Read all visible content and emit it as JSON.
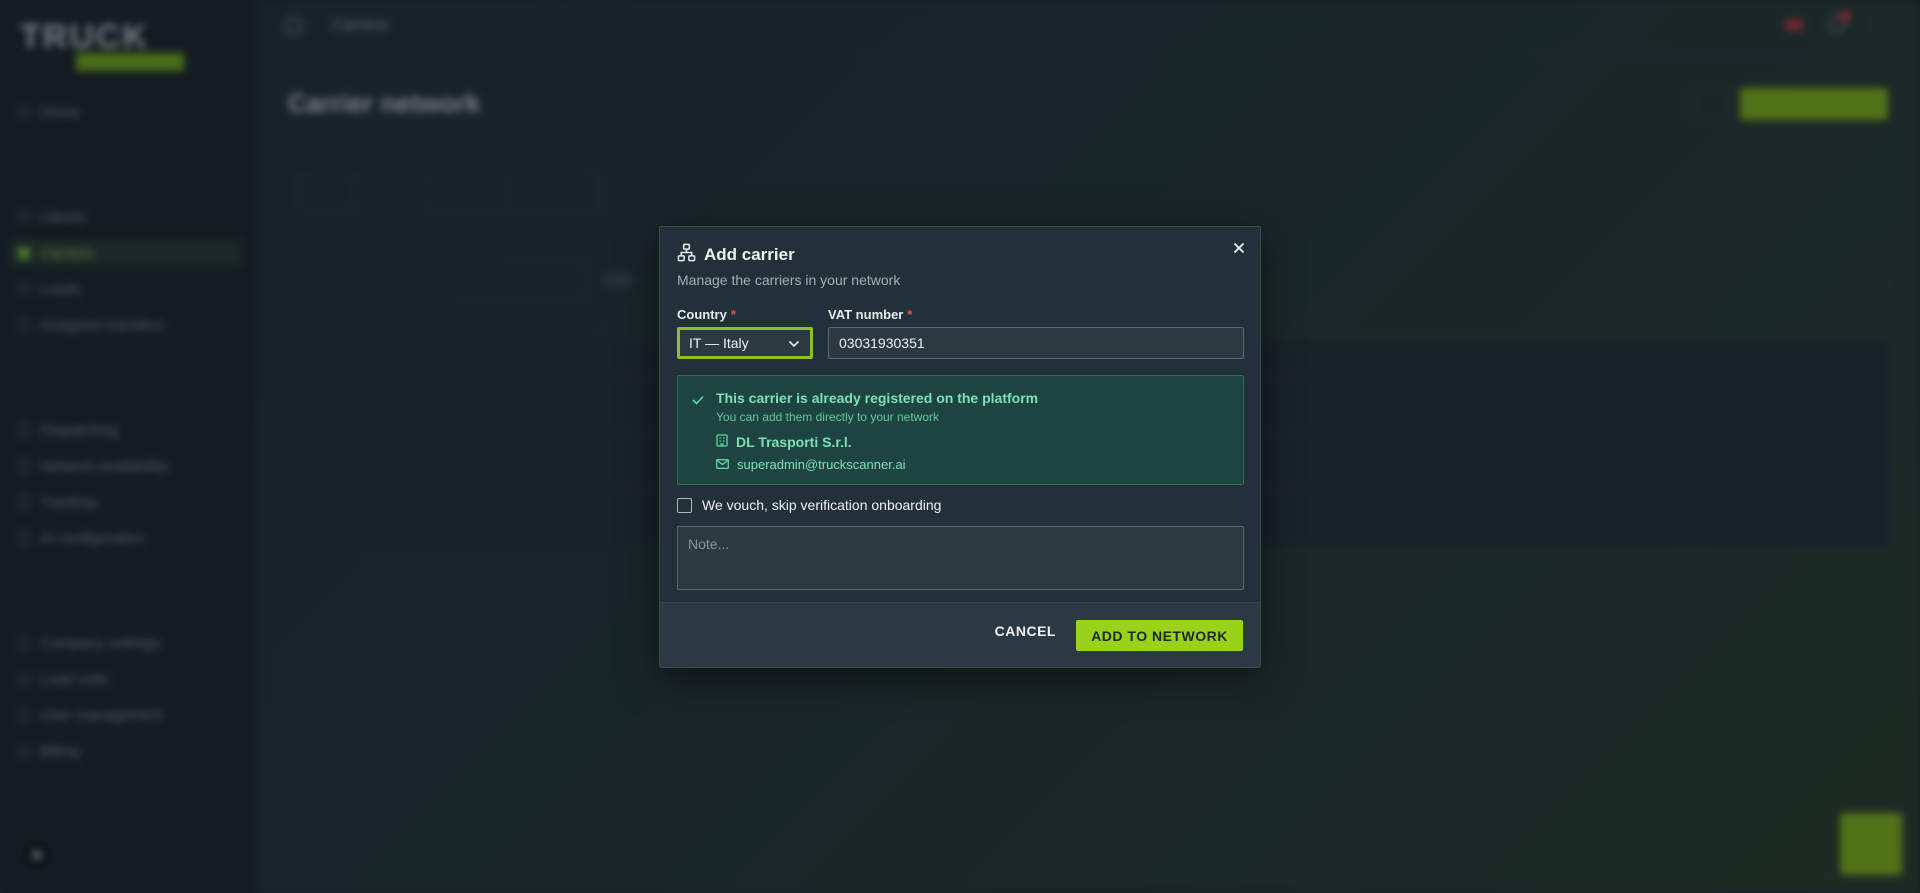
{
  "background": {
    "logo_text": "TRUCK",
    "sidebar": {
      "items": [
        {
          "label": "Home",
          "active": false
        },
        {
          "label": "Clients",
          "active": false
        },
        {
          "label": "Carriers",
          "active": true
        },
        {
          "label": "Loads",
          "active": false
        },
        {
          "label": "Assigned transfers",
          "active": false
        },
        {
          "label": "Dispatching",
          "active": false
        },
        {
          "label": "Network availability",
          "active": false
        },
        {
          "label": "Tracking",
          "active": false
        },
        {
          "label": "AI configuration",
          "active": false
        },
        {
          "label": "Company settings",
          "active": false
        },
        {
          "label": "Load units",
          "active": false
        },
        {
          "label": "User management",
          "active": false
        },
        {
          "label": "Billing",
          "active": false
        }
      ]
    },
    "user": {
      "initial": "N"
    },
    "topbar": {
      "breadcrumb": "Carriers"
    },
    "page_title": "Carrier network"
  },
  "modal": {
    "title": "Add carrier",
    "subtitle": "Manage the carriers in your network",
    "country_label": "Country",
    "country_value": "IT — Italy",
    "vat_label": "VAT number",
    "vat_value": "03031930351",
    "found": {
      "title": "This carrier is already registered on the platform",
      "subtitle": "You can add them directly to your network",
      "company": "DL Trasporti S.r.l.",
      "email": "superadmin@truckscanner.ai"
    },
    "vouch_label": "We vouch, skip verification onboarding",
    "note_placeholder": "Note...",
    "cancel_label": "CANCEL",
    "add_label": "ADD TO NETWORK"
  },
  "colors": {
    "accent": "#9ad21a",
    "success_text": "#7fe0b8",
    "success_bg": "#1d4440",
    "modal_bg": "#223039",
    "required": "#e05454"
  }
}
